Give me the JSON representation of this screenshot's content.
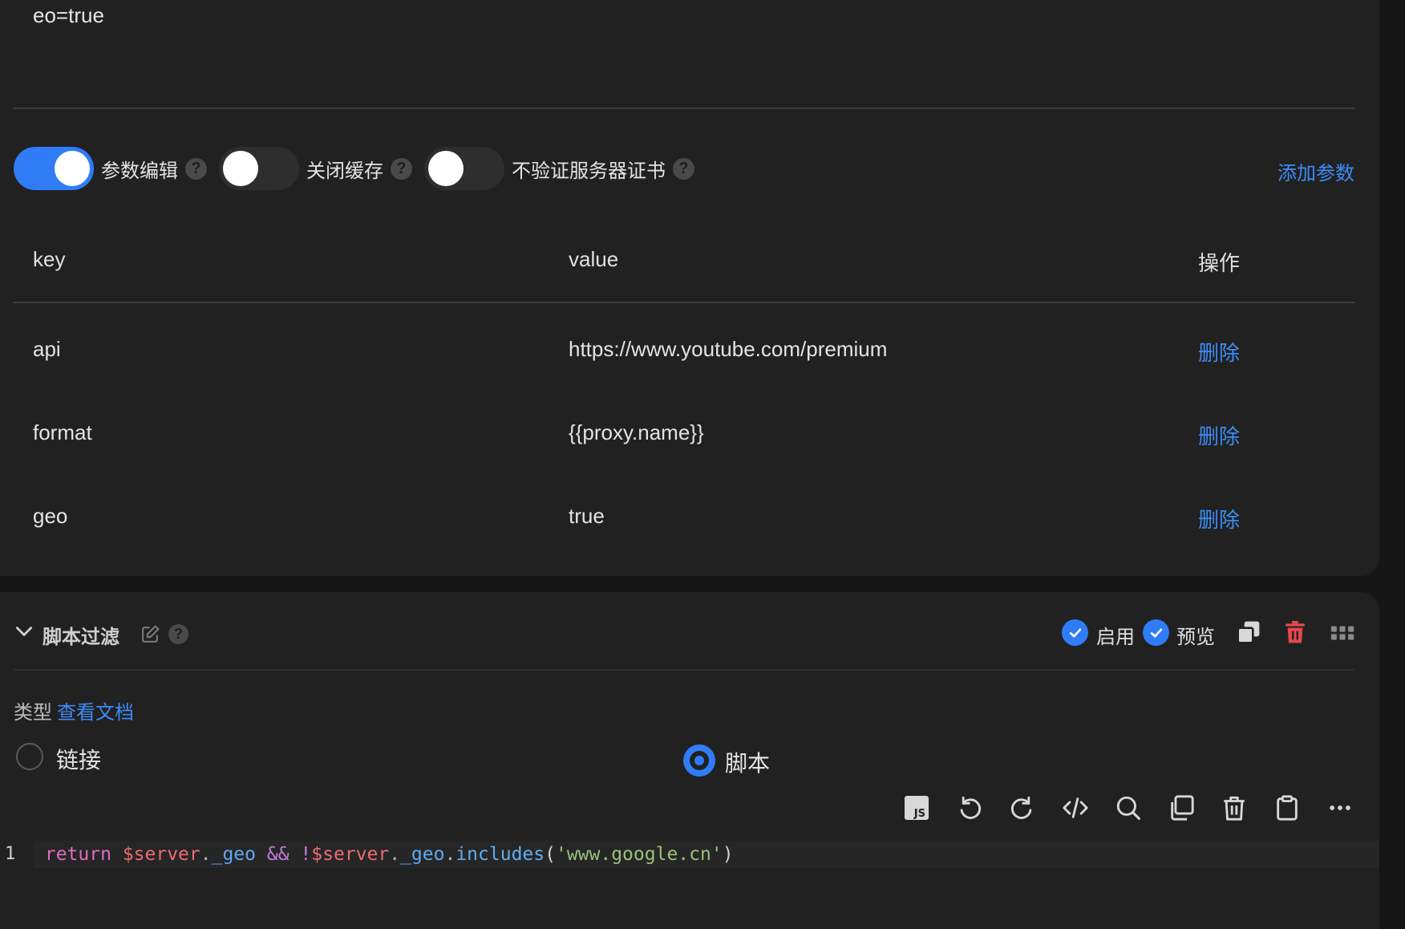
{
  "url_fragment": "eo=true",
  "toggles": [
    {
      "label": "参数编辑",
      "on": true
    },
    {
      "label": "关闭缓存",
      "on": false
    },
    {
      "label": "不验证服务器证书",
      "on": false
    }
  ],
  "help_glyph": "?",
  "add_param_label": "添加参数",
  "table": {
    "headers": {
      "key": "key",
      "value": "value",
      "action": "操作"
    },
    "rows": [
      {
        "key": "api",
        "value": "https://www.youtube.com/premium",
        "action": "删除"
      },
      {
        "key": "format",
        "value": "{{proxy.name}}",
        "action": "删除"
      },
      {
        "key": "geo",
        "value": "true",
        "action": "删除"
      }
    ]
  },
  "script_section": {
    "title": "脚本过滤",
    "enable_label": "启用",
    "preview_label": "预览",
    "type_label": "类型",
    "docs_link": "查看文档",
    "radio_link": "链接",
    "radio_script": "脚本",
    "selected": "脚本"
  },
  "editor": {
    "line_number": "1",
    "tokens": [
      {
        "t": "return",
        "c": "kw"
      },
      {
        "t": " ",
        "c": "punc"
      },
      {
        "t": "$server",
        "c": "var"
      },
      {
        "t": ".",
        "c": "dot"
      },
      {
        "t": "_geo",
        "c": "prop"
      },
      {
        "t": " ",
        "c": "punc"
      },
      {
        "t": "&&",
        "c": "op"
      },
      {
        "t": " ",
        "c": "punc"
      },
      {
        "t": "!",
        "c": "op"
      },
      {
        "t": "$server",
        "c": "var"
      },
      {
        "t": ".",
        "c": "dot"
      },
      {
        "t": "_geo",
        "c": "prop"
      },
      {
        "t": ".",
        "c": "dot"
      },
      {
        "t": "includes",
        "c": "fn"
      },
      {
        "t": "(",
        "c": "punc"
      },
      {
        "t": "'www.google.cn'",
        "c": "str"
      },
      {
        "t": ")",
        "c": "punc"
      }
    ],
    "toolbar_icons": [
      "js-file-icon",
      "undo-icon",
      "redo-icon",
      "code-format-icon",
      "search-icon",
      "copy-icon",
      "trash-icon",
      "clipboard-icon",
      "more-icon"
    ]
  },
  "colors": {
    "accent": "#2f7cf6",
    "danger": "#e5484d",
    "link": "#3b8cf7"
  }
}
